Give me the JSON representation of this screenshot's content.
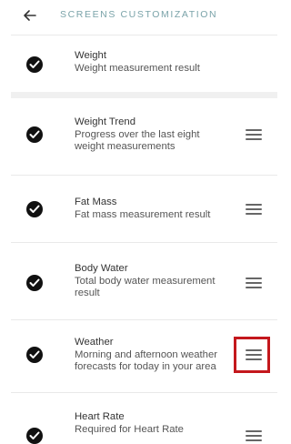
{
  "header": {
    "title": "SCREENS CUSTOMIZATION",
    "back_icon": "arrow-left-icon"
  },
  "colors": {
    "title": "#7aa3a9",
    "highlight": "#c4181d",
    "check": "#111111"
  },
  "screens": [
    {
      "name": "Weight",
      "description": "Weight measurement result",
      "enabled": true,
      "reorderable": false
    },
    {
      "name": "Weight Trend",
      "description": "Progress over the last eight weight measurements",
      "enabled": true,
      "reorderable": true
    },
    {
      "name": "Fat Mass",
      "description": "Fat mass measurement result",
      "enabled": true,
      "reorderable": true
    },
    {
      "name": "Body Water",
      "description": "Total body water measurement result",
      "enabled": true,
      "reorderable": true
    },
    {
      "name": "Weather",
      "description": "Morning and afternoon weather forecasts for today in your area",
      "enabled": true,
      "reorderable": true,
      "highlighted": true
    },
    {
      "name": "Heart Rate",
      "description": "Required for Heart Rate",
      "enabled": true,
      "reorderable": true
    }
  ]
}
